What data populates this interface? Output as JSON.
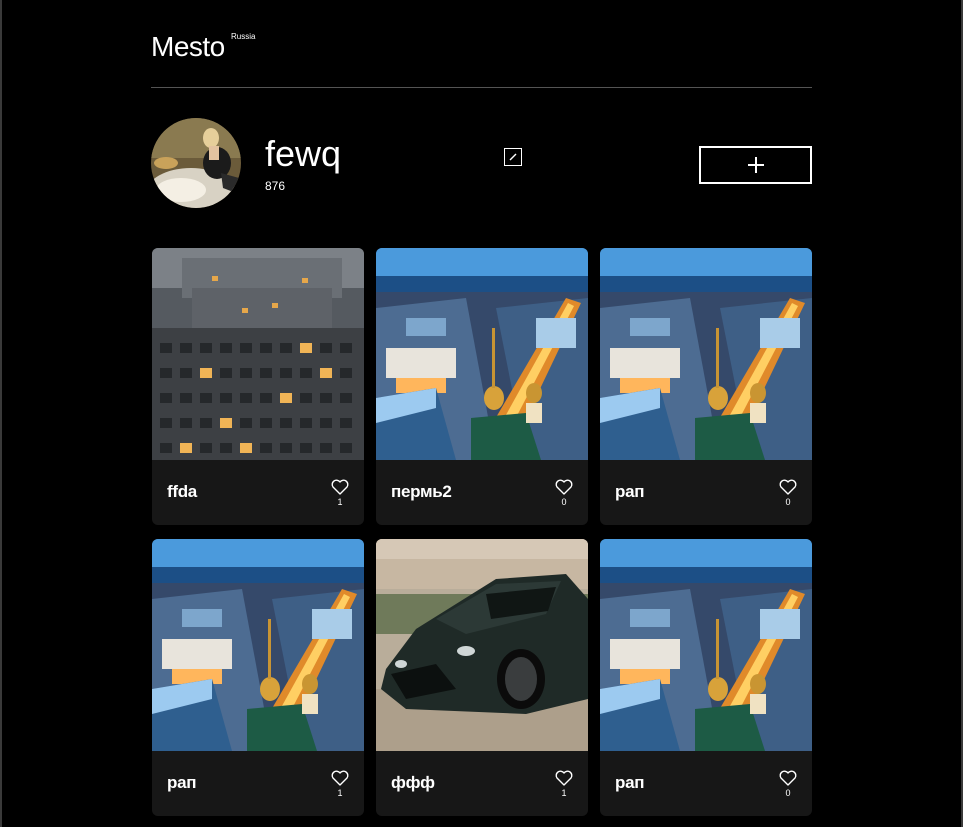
{
  "header": {
    "logo": "Mesto",
    "logo_sup": "Russia"
  },
  "profile": {
    "name": "fewq",
    "about": "876",
    "edit_icon": "pencil-icon",
    "add_icon": "plus-icon"
  },
  "cards": [
    {
      "title": "ffda",
      "likes": "1",
      "image": "building-block-photo"
    },
    {
      "title": "пермь2",
      "likes": "0",
      "image": "city-night-photo"
    },
    {
      "title": "рап",
      "likes": "0",
      "image": "city-night-photo"
    },
    {
      "title": "рап",
      "likes": "1",
      "image": "city-night-photo"
    },
    {
      "title": "ффф",
      "likes": "1",
      "image": "sports-car-photo"
    },
    {
      "title": "рап",
      "likes": "0",
      "image": "city-night-photo"
    }
  ],
  "colors": {
    "background": "#000000",
    "card": "#171717",
    "text": "#ffffff",
    "divider": "#545454"
  }
}
